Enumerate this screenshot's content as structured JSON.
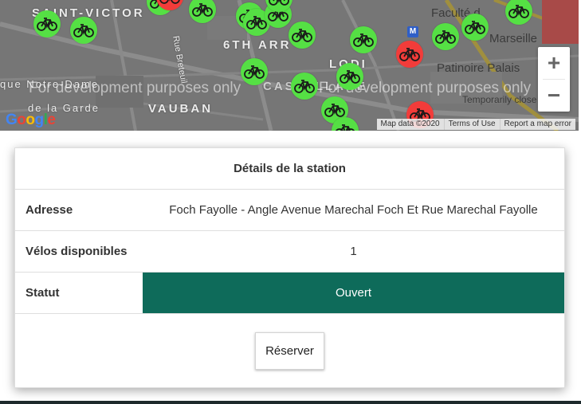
{
  "map": {
    "labels": {
      "saint_victor": "SAINT-VICTOR",
      "sixth_arr": "6TH ARR",
      "lodi": "LODI",
      "vauban": "VAUBAN",
      "castellane": "CASTELLANE",
      "notre_dame": "que Notre-Dame",
      "de_la_garde": "de la Garde",
      "faculte": "Faculté d",
      "marseille": "Marseille",
      "patinoire": "Patinoire Palais",
      "temporarily": "Temporarily close",
      "breteuil": "Rue Breteuil"
    },
    "dev_notice": "For development purposes only",
    "zoom_in": "+",
    "zoom_out": "−",
    "google_logo": "Google",
    "metro": "M",
    "attribution": {
      "map_data": "Map data ©2020",
      "terms": "Terms of Use",
      "report": "Report a map error"
    },
    "colors": {
      "available": "#55e044",
      "unavailable": "#f23c3a"
    }
  },
  "station": {
    "title": "Détails de la station",
    "address_label": "Adresse",
    "address_value": "Foch Fayolle - Angle Avenue Marechal Foch Et Rue Marechal Fayolle",
    "bikes_label": "Vélos disponibles",
    "bikes_value": "1",
    "status_label": "Statut",
    "status_value": "Ouvert",
    "status_color": "#0e6b5a",
    "reserve_label": "Réserver"
  }
}
